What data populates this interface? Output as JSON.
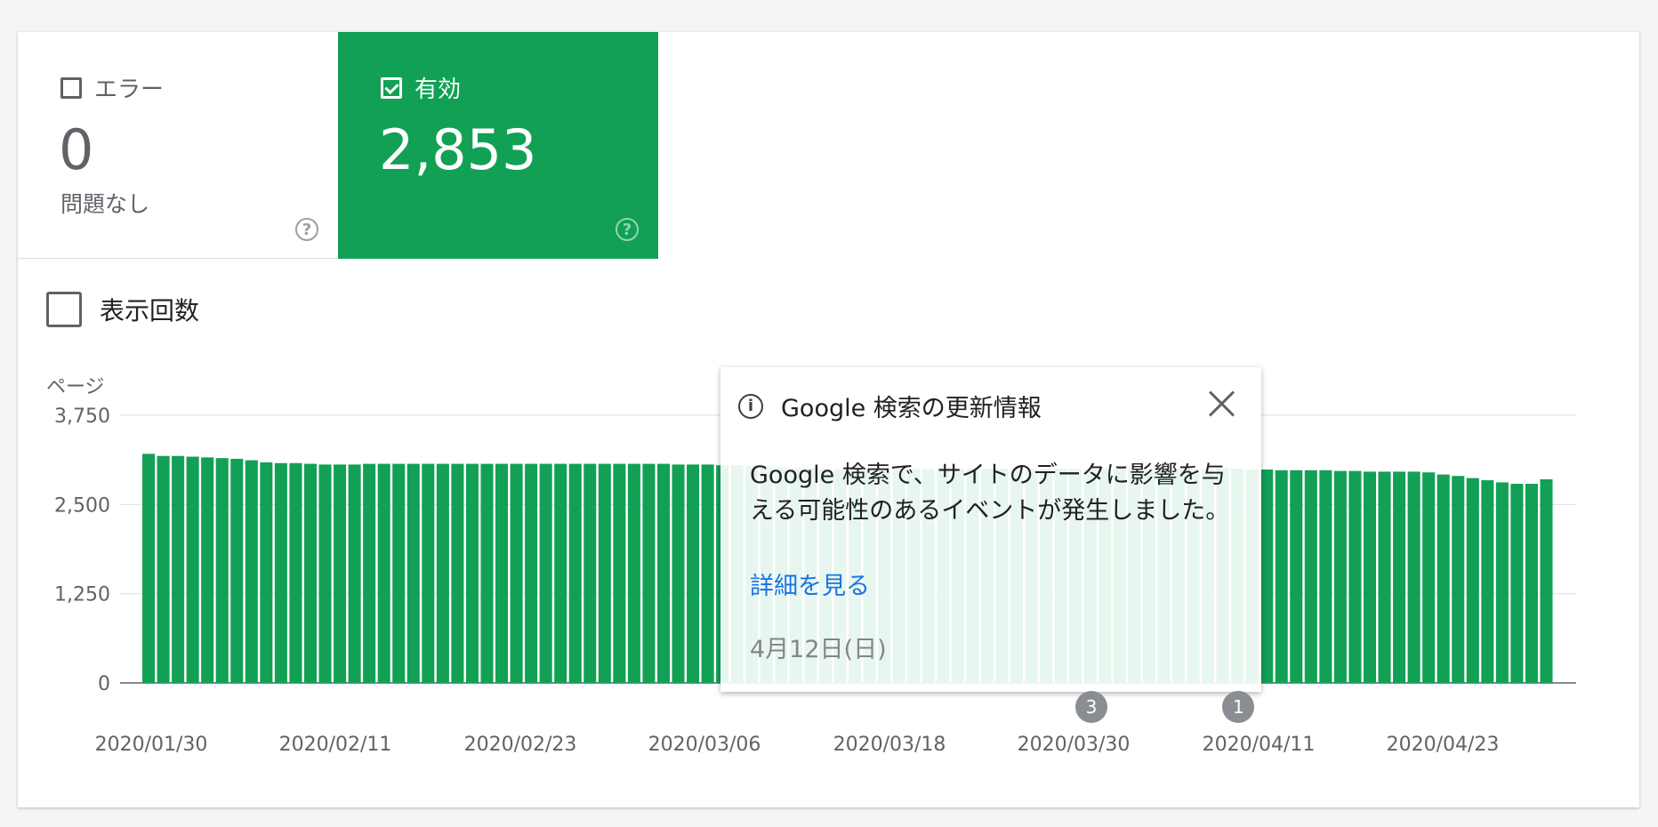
{
  "tiles": {
    "error": {
      "label": "エラー",
      "value": "0",
      "sub": "問題なし",
      "checked": false
    },
    "valid": {
      "label": "有効",
      "value": "2,853",
      "checked": true,
      "color": "#12a055"
    }
  },
  "impressions": {
    "label": "表示回数",
    "checked": false
  },
  "chart_data": {
    "type": "bar",
    "ylabel": "ページ",
    "ylim": [
      0,
      3750
    ],
    "yticks": [
      "3,750",
      "2,500",
      "1,250",
      "0"
    ],
    "ytick_values": [
      3750,
      2500,
      1250,
      0
    ],
    "xtick_labels": [
      "2020/01/30",
      "2020/02/11",
      "2020/02/23",
      "2020/03/06",
      "2020/03/18",
      "2020/03/30",
      "2020/04/11",
      "2020/04/23"
    ],
    "bar_color": "#12a055",
    "grid": true,
    "values": [
      3210,
      3180,
      3180,
      3170,
      3160,
      3150,
      3140,
      3120,
      3090,
      3080,
      3080,
      3070,
      3060,
      3060,
      3060,
      3070,
      3070,
      3070,
      3070,
      3070,
      3070,
      3070,
      3070,
      3070,
      3070,
      3070,
      3070,
      3070,
      3070,
      3070,
      3070,
      3070,
      3070,
      3070,
      3070,
      3070,
      3060,
      3060,
      3060,
      3050,
      3050,
      3040,
      3030,
      3020,
      3010,
      3010,
      3000,
      3000,
      3000,
      3000,
      3000,
      3000,
      3000,
      3000,
      3000,
      3000,
      3000,
      3000,
      3000,
      3000,
      3000,
      3000,
      3000,
      3000,
      3000,
      3000,
      3000,
      3000,
      3000,
      3000,
      3000,
      3000,
      3000,
      3010,
      3000,
      2990,
      2990,
      2980,
      2980,
      2980,
      2980,
      2970,
      2970,
      2960,
      2960,
      2960,
      2960,
      2950,
      2920,
      2900,
      2870,
      2840,
      2810,
      2790,
      2790,
      2853
    ]
  },
  "annotations": [
    {
      "label": "3",
      "category_index": 64
    },
    {
      "label": "1",
      "category_index": 74
    }
  ],
  "popup": {
    "title": "Google 検索の更新情報",
    "body": "Google 検索で、サイトのデータに影響を与える可能性のあるイベントが発生しました。",
    "link": "詳細を見る",
    "date": "4月12日(日)"
  }
}
